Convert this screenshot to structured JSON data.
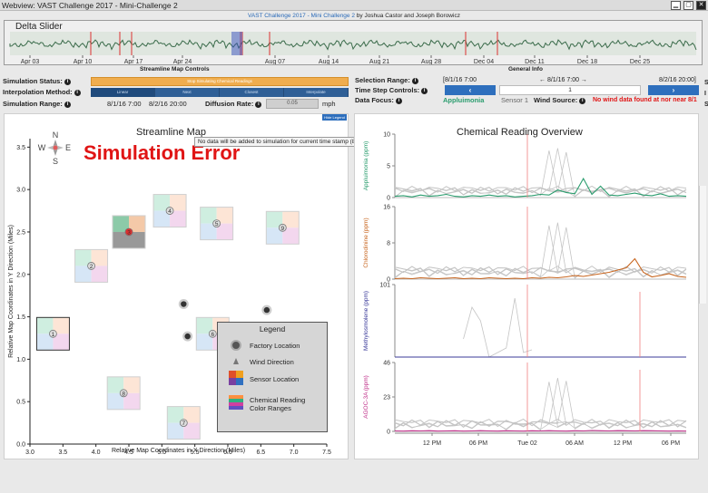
{
  "window": {
    "title": "Webview: VAST Challenge 2017 - Mini-Challenge 2"
  },
  "header": {
    "link": "VAST Challenge 2017 - Mini Challenge 2",
    "authors": " by Joshua Castor and Joseph Borowicz"
  },
  "delta": {
    "title": "Delta Slider",
    "ticks": [
      "Apr 03",
      "Apr 10",
      "Apr 17",
      "Apr 24",
      "Aug 07",
      "Aug 14",
      "Aug 21",
      "Aug 28",
      "Dec 04",
      "Dec 11",
      "Dec 18",
      "Dec 25"
    ]
  },
  "controls": {
    "title": "Streamline Map Controls",
    "status_label": "Simulation Status:",
    "status_text": "Stop Simulating Chemical Readings",
    "interp_label": "Interpolation Method:",
    "interp_options": [
      "Linear",
      "Next",
      "Closest",
      "Interpolate"
    ],
    "range_label": "Simulation Range:",
    "range_start": "8/1/16 7:00",
    "range_end": "8/2/16 20:00",
    "rate_label": "Diffusion Rate:",
    "rate_value": "0.05",
    "rate_unit": "mph"
  },
  "general": {
    "title": "General Info",
    "selection_label": "Selection Range:",
    "selection_start": "[8/1/16 7:00",
    "selection_cur": "← 8/1/16 7:00 →",
    "selection_end": "8/2/16 20:00]",
    "timestep_label": "Time Step Controls:",
    "step_value": "1",
    "focus_label": "Data Focus:",
    "focus_value": "Appluimonia",
    "sensor_label": "Sensor 1",
    "wind_label": "Wind Source:",
    "wind_value": "No wind data found at nor near 8/1",
    "prev_glyph": "‹",
    "next_glyph": "›"
  },
  "map": {
    "title": "Streamline Map",
    "tooltip": "No data will be added to simulation for current time stamp (8/1/16 7:00) as there is no wind data.",
    "error": "Simulation Error",
    "hide_legend": "Hide Legend",
    "xlabel": "Relative Map Coordinates in X Direction (Miles)",
    "ylabel": "Relative Map Coordinates in Y Direction (Miles)",
    "compass": {
      "n": "N",
      "s": "S",
      "e": "E",
      "w": "W"
    },
    "xticks": [
      "3.0",
      "3.5",
      "4.0",
      "4.5",
      "5.0",
      "5.5",
      "6.0",
      "6.5",
      "7.0",
      "7.5"
    ],
    "yticks": [
      "3.5",
      "3.0",
      "2.5",
      "2.0",
      "1.5",
      "1.0",
      "0.5",
      "0.0"
    ],
    "legend": {
      "title": "Legend",
      "factory": "Factory Location",
      "wind": "Wind Direction",
      "sensor": "Sensor Location",
      "chem1": "Chemical Reading",
      "chem2": "Color Ranges"
    },
    "sensors": [
      {
        "id": "1",
        "x": 3.35,
        "y": 1.3
      },
      {
        "id": "2",
        "x": 3.93,
        "y": 2.1
      },
      {
        "id": "3",
        "x": 4.5,
        "y": 2.5
      },
      {
        "id": "4",
        "x": 5.12,
        "y": 2.75
      },
      {
        "id": "5",
        "x": 5.83,
        "y": 2.6
      },
      {
        "id": "6",
        "x": 5.77,
        "y": 1.3
      },
      {
        "id": "7",
        "x": 5.33,
        "y": 0.25
      },
      {
        "id": "8",
        "x": 4.42,
        "y": 0.6
      },
      {
        "id": "9",
        "x": 6.83,
        "y": 2.55
      }
    ],
    "factories": [
      {
        "x": 5.33,
        "y": 1.65
      },
      {
        "x": 5.39,
        "y": 1.27
      },
      {
        "x": 6.59,
        "y": 1.58
      },
      {
        "x": 7.2,
        "y": 1.33
      }
    ]
  },
  "chart_data": {
    "type": "line",
    "title": "Chemical Reading Overview",
    "xticks": [
      "12 PM",
      "06 PM",
      "Tue 02",
      "06 AM",
      "12 PM",
      "06 PM"
    ],
    "series": [
      {
        "name": "Appluimonia (ppm)",
        "color": "#2a9d6e",
        "yticks": [
          "10",
          "5",
          "0"
        ],
        "ylim": [
          0,
          10
        ],
        "values": [
          0.2,
          0.3,
          0.1,
          0.4,
          0.2,
          0.3,
          0.5,
          0.2,
          0.1,
          0.3,
          0.2,
          0.4,
          0.2,
          0.3,
          0.1,
          0.2,
          0.3,
          0.5,
          0.4,
          1.2,
          0.8,
          0.6,
          3.0,
          0.5,
          1.8,
          0.4,
          0.3,
          0.5,
          0.7,
          0.4,
          0.3,
          0.6,
          0.2,
          0.3,
          0.2
        ]
      },
      {
        "name": "Chlorodinine (ppm)",
        "color": "#c8651e",
        "yticks": [
          "16",
          "8",
          "0"
        ],
        "ylim": [
          0,
          16
        ],
        "values": [
          0.1,
          0.2,
          0.1,
          0.3,
          0.2,
          0.1,
          0.2,
          0.3,
          0.1,
          0.2,
          0.1,
          0.3,
          0.2,
          0.1,
          0.2,
          0.1,
          0.3,
          0.2,
          0.4,
          0.3,
          0.5,
          0.8,
          0.6,
          0.9,
          1.2,
          1.5,
          2.0,
          2.5,
          4.5,
          1.5,
          0.5,
          0.8,
          1.2,
          0.6,
          0.4
        ]
      },
      {
        "name": "Methylosmolene (ppm)",
        "color": "#3b3b9a",
        "yticks": [
          "101"
        ],
        "ylim": [
          0,
          101
        ],
        "values": [
          0,
          0,
          0,
          0,
          0,
          0,
          0,
          0,
          0,
          0,
          0,
          0,
          0,
          0,
          0,
          0,
          0,
          0,
          0,
          0,
          0,
          0,
          0,
          0,
          0,
          0,
          0,
          0,
          0,
          0,
          0,
          0,
          0,
          0,
          0
        ]
      },
      {
        "name": "AGOC-3A (ppm)",
        "color": "#c0308a",
        "yticks": [
          "46",
          "23",
          "0"
        ],
        "ylim": [
          0,
          46
        ],
        "values": [
          0.3,
          0.2,
          0.4,
          0.3,
          0.5,
          0.2,
          0.3,
          0.4,
          0.2,
          0.3,
          0.5,
          0.3,
          0.2,
          0.4,
          0.3,
          0.2,
          0.4,
          0.3,
          0.5,
          0.3,
          0.2,
          0.4,
          0.3,
          0.6,
          0.4,
          0.3,
          0.5,
          0.4,
          0.3,
          0.5,
          0.4,
          0.3,
          0.2,
          0.3,
          0.2
        ]
      }
    ]
  }
}
